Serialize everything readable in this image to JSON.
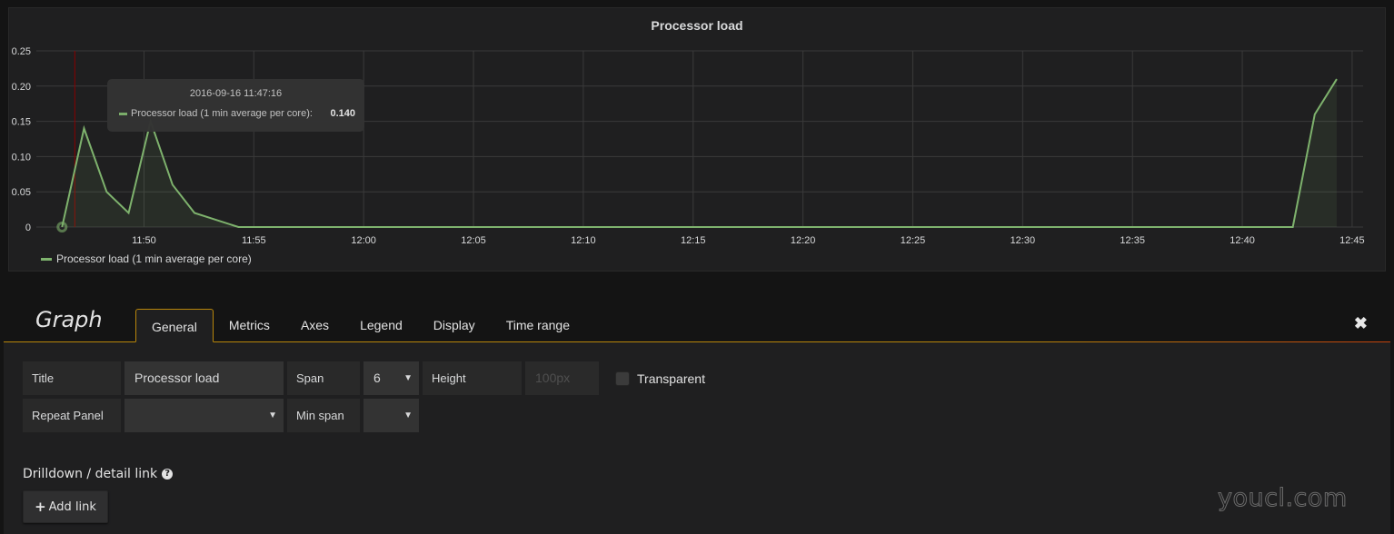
{
  "panel": {
    "title": "Processor load"
  },
  "tooltip": {
    "time": "2016-09-16 11:47:16",
    "series_label": "Processor load (1 min average per core):",
    "value": "0.140"
  },
  "colors": {
    "series": "#7eb26d",
    "crosshair": "#8b0000",
    "accent": "#b8860b"
  },
  "chart_data": {
    "type": "area",
    "title": "Processor load",
    "xlabel": "",
    "ylabel": "",
    "x_unit": "minutes after 11:50",
    "x_range": [
      -4.9,
      55.5
    ],
    "ylim": [
      0,
      0.25
    ],
    "yticks": [
      0,
      0.05,
      0.1,
      0.15,
      0.2,
      0.25
    ],
    "ytick_labels": [
      "0",
      "0.05",
      "0.10",
      "0.15",
      "0.20",
      "0.25"
    ],
    "xticks": [
      0,
      5,
      10,
      15,
      20,
      25,
      30,
      35,
      40,
      45,
      50,
      55
    ],
    "xtick_labels": [
      "11:50",
      "11:55",
      "12:00",
      "12:05",
      "12:10",
      "12:15",
      "12:20",
      "12:25",
      "12:30",
      "12:35",
      "12:40",
      "12:45"
    ],
    "grid": true,
    "legend_position": "bottom-left",
    "crosshair_x": -3.15,
    "series": [
      {
        "name": "Processor load (1 min average per core)",
        "points": [
          [
            -3.73,
            0
          ],
          [
            -2.73,
            0.14
          ],
          [
            -1.7,
            0.05
          ],
          [
            -0.7,
            0.02
          ],
          [
            0.3,
            0.15
          ],
          [
            1.3,
            0.06
          ],
          [
            2.3,
            0.02
          ],
          [
            4.3,
            0
          ],
          [
            52.3,
            0
          ],
          [
            53.3,
            0.16
          ],
          [
            54.3,
            0.21
          ]
        ],
        "highlighted_point": [
          -3.73,
          0
        ]
      }
    ]
  },
  "editor": {
    "title": "Graph",
    "tabs": [
      "General",
      "Metrics",
      "Axes",
      "Legend",
      "Display",
      "Time range"
    ],
    "active_tab": "General",
    "close_label": "✖",
    "fields": {
      "title_label": "Title",
      "title_value": "Processor load",
      "span_label": "Span",
      "span_value": "6",
      "height_label": "Height",
      "height_placeholder": "100px",
      "transparent_label": "Transparent",
      "repeat_label": "Repeat Panel",
      "repeat_value": "",
      "min_span_label": "Min span",
      "min_span_value": ""
    },
    "caret": "▼",
    "drilldown_title": "Drilldown / detail link",
    "help_icon": "?",
    "add_link_plus": "+",
    "add_link_label": "Add link"
  },
  "watermark": "youcl.com"
}
